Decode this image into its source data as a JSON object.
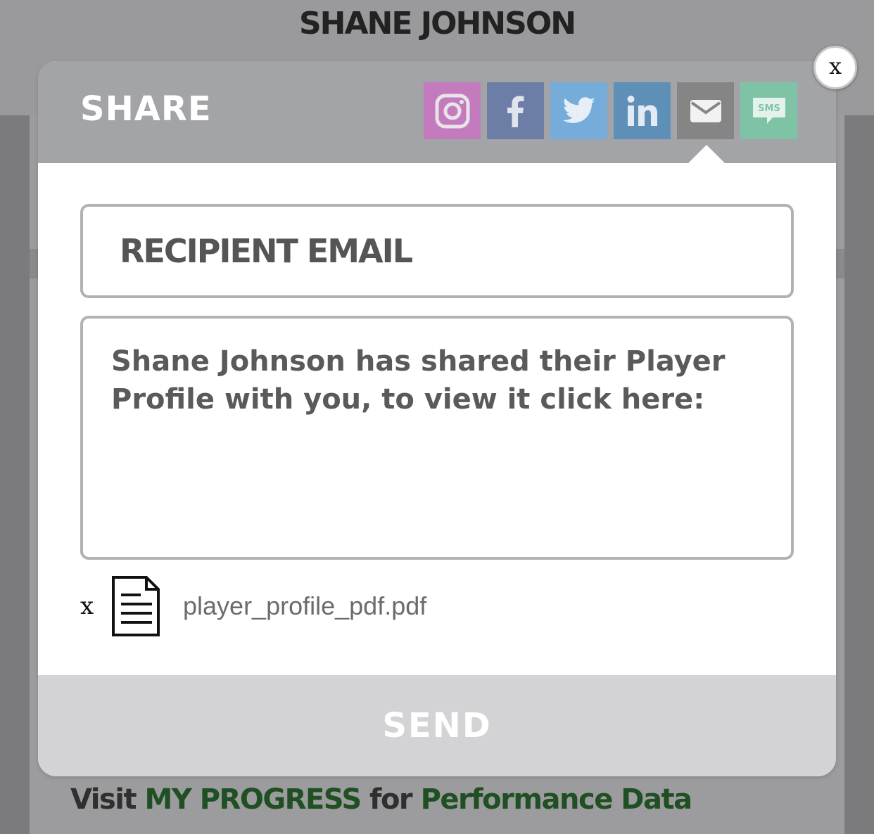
{
  "page": {
    "profile_name": "SHANE JOHNSON",
    "footer": {
      "prefix": "Visit ",
      "link1": "MY PROGRESS",
      "middle": " for ",
      "link2": "Performance Data"
    }
  },
  "modal": {
    "title": "SHARE",
    "close_label": "x",
    "share_options": [
      {
        "name": "instagram",
        "icon": "instagram-icon",
        "color": "#c37bbd"
      },
      {
        "name": "facebook",
        "icon": "facebook-icon",
        "color": "#6d7ea6"
      },
      {
        "name": "twitter",
        "icon": "twitter-icon",
        "color": "#75acd9"
      },
      {
        "name": "linkedin",
        "icon": "linkedin-icon",
        "color": "#5e8fb6"
      },
      {
        "name": "email",
        "icon": "envelope-icon",
        "color": "#858585",
        "selected": true
      },
      {
        "name": "sms",
        "icon": "sms-icon",
        "color": "#7ec3a6",
        "label": "SMS"
      }
    ],
    "recipient_placeholder": "RECIPIENT EMAIL",
    "message": "Shane Johnson has shared their Player Profile with you, to view it click here:",
    "attachment": {
      "remove_label": "x",
      "filename": "player_profile_pdf.pdf"
    },
    "send_label": "SEND"
  }
}
